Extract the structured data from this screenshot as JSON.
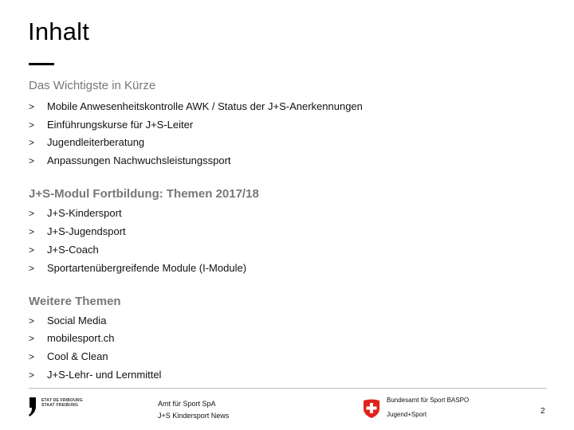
{
  "title": "Inhalt",
  "sections": [
    {
      "heading": "Das Wichtigste in Kürze",
      "items": [
        "Mobile Anwesenheitskontrolle AWK / Status der J+S-Anerkennungen",
        "Einführungskurse für J+S-Leiter",
        "Jugendleiterberatung",
        "Anpassungen Nachwuchsleistungssport"
      ]
    },
    {
      "heading": "J+S-Modul Fortbildung: Themen 2017/18",
      "items": [
        "J+S-Kindersport",
        "J+S-Jugendsport",
        "J+S-Coach",
        "Sportartenübergreifende Module (I-Module)"
      ]
    },
    {
      "heading": "Weitere Themen",
      "items": [
        "Social Media",
        "mobilesport.ch",
        "Cool & Clean",
        "J+S-Lehr- und Lernmittel"
      ]
    }
  ],
  "bullet_glyph": ">",
  "footer": {
    "fribourg_logo": {
      "line1": "ETAT DE FRIBOURG",
      "line2": "STAAT FREIBURG"
    },
    "middle": {
      "line1": "Amt für Sport SpA",
      "line2": "J+S Kindersport News"
    },
    "right": {
      "line1": "Bundesamt für Sport BASPO",
      "line2": "Jugend+Sport"
    },
    "page_number": "2"
  },
  "colors": {
    "heading_gray": "#777777",
    "swiss_red": "#e2231a"
  }
}
